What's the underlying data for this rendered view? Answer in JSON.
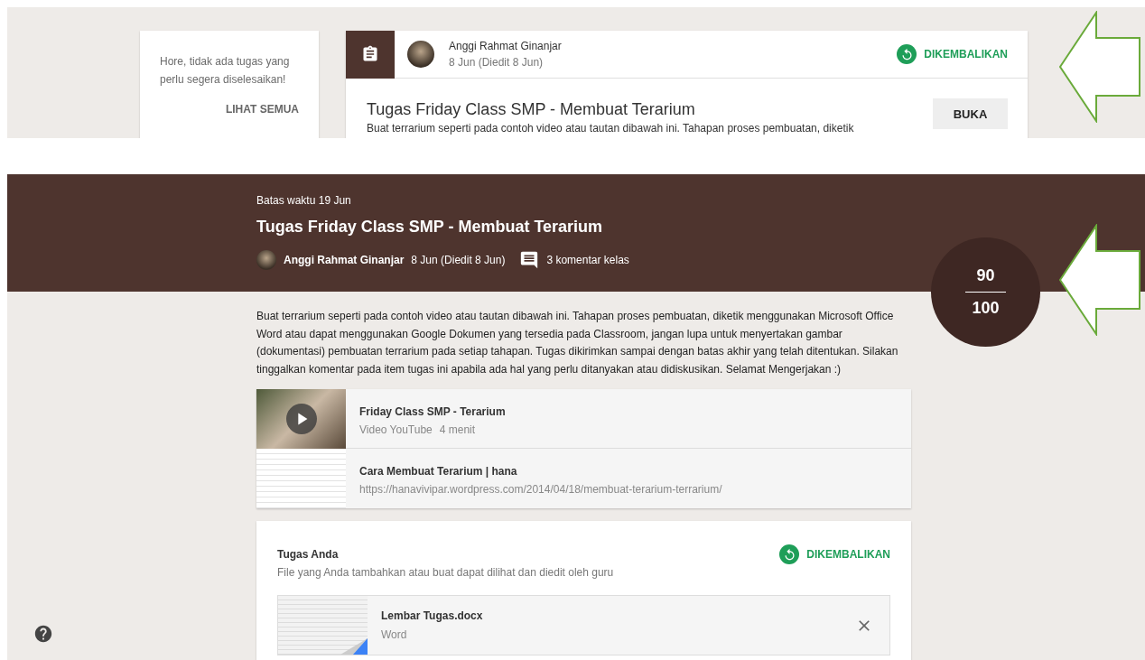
{
  "top_screen": {
    "todo_card": {
      "message": "Hore, tidak ada tugas yang perlu segera diselesaikan!",
      "link": "LIHAT SEMUA"
    },
    "assignment_card": {
      "author": "Anggi Rahmat Ginanjar",
      "date": "8 Jun (Diedit 8 Jun)",
      "status": "DIKEMBALIKAN",
      "title": "Tugas Friday Class SMP - Membuat Terarium",
      "excerpt": "Buat terrarium seperti pada contoh video atau tautan dibawah ini. Tahapan proses pembuatan, diketik",
      "button": "BUKA"
    }
  },
  "assignment": {
    "due": "Batas waktu 19 Jun",
    "title": "Tugas Friday Class SMP - Membuat Terarium",
    "author": "Anggi Rahmat Ginanjar",
    "date": "8 Jun (Diedit 8 Jun)",
    "comments": "3 komentar kelas",
    "grade": {
      "score": "90",
      "total": "100"
    },
    "description": "Buat terrarium seperti pada contoh video atau tautan dibawah ini. Tahapan proses pembuatan, diketik menggunakan Microsoft Office Word atau dapat menggunakan Google Dokumen yang tersedia pada Classroom, jangan lupa untuk menyertakan gambar (dokumentasi) pembuatan terrarium pada setiap tahapan. Tugas dikirimkan sampai dengan batas akhir yang telah ditentukan. Silakan tinggalkan komentar pada item tugas ini apabila ada hal yang perlu ditanyakan atau didiskusikan. Selamat Mengerjakan :)",
    "materials": [
      {
        "kind": "video",
        "title": "Friday Class SMP - Terarium",
        "source": "Video YouTube",
        "duration": "4 menit"
      },
      {
        "kind": "link",
        "title": "Cara Membuat Terarium | hana",
        "url": "https://hanavivipar.wordpress.com/2014/04/18/membuat-terarium-terrarium/"
      }
    ],
    "your_work": {
      "title": "Tugas Anda",
      "status": "DIKEMBALIKAN",
      "note": "File yang Anda tambahkan atau buat dapat dilihat dan diedit oleh guru",
      "files": [
        {
          "name": "Lembar Tugas.docx",
          "type": "Word"
        }
      ]
    }
  }
}
